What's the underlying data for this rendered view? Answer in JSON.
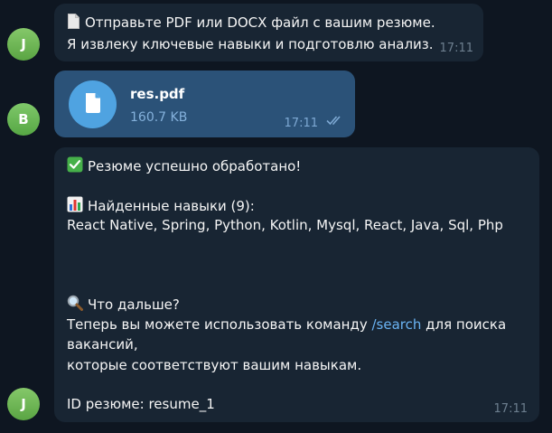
{
  "messages": {
    "m1": {
      "avatar_letter": "J",
      "icon": "page-icon",
      "line1": "Отправьте PDF или DOCX файл с вашим резюме.",
      "line2": "Я извлеку ключевые навыки и подготовлю анализ.",
      "time": "17:11"
    },
    "m2": {
      "avatar_letter": "B",
      "file_icon": "document-icon",
      "file_name": "res.pdf",
      "file_size": "160.7 KB",
      "time": "17:11",
      "status_icon": "double-check-icon"
    },
    "m3": {
      "avatar_letter": "J",
      "success_icon": "check-mark-icon",
      "success_text": "Резюме успешно обработано!",
      "skills_icon": "bar-chart-icon",
      "skills_header": "Найденные навыки (9):",
      "skills_list": "React Native, Spring, Python, Kotlin, Mysql, React, Java, Sql, Php",
      "next_icon": "magnifier-icon",
      "next_header": "Что дальше?",
      "next_line1_prefix": "Теперь вы можете использовать команду ",
      "next_command": "/search",
      "next_line1_suffix": " для поиска",
      "next_line2": "вакансий,",
      "next_line3": "которые соответствуют вашим навыкам.",
      "resume_id": "ID резюме: resume_1",
      "time": "17:11"
    }
  },
  "colors": {
    "background": "#0e1621",
    "incoming_bubble": "#182533",
    "outgoing_bubble": "#2b5278",
    "link": "#6ab3f3",
    "file_icon_bg": "#4fa3e1"
  }
}
